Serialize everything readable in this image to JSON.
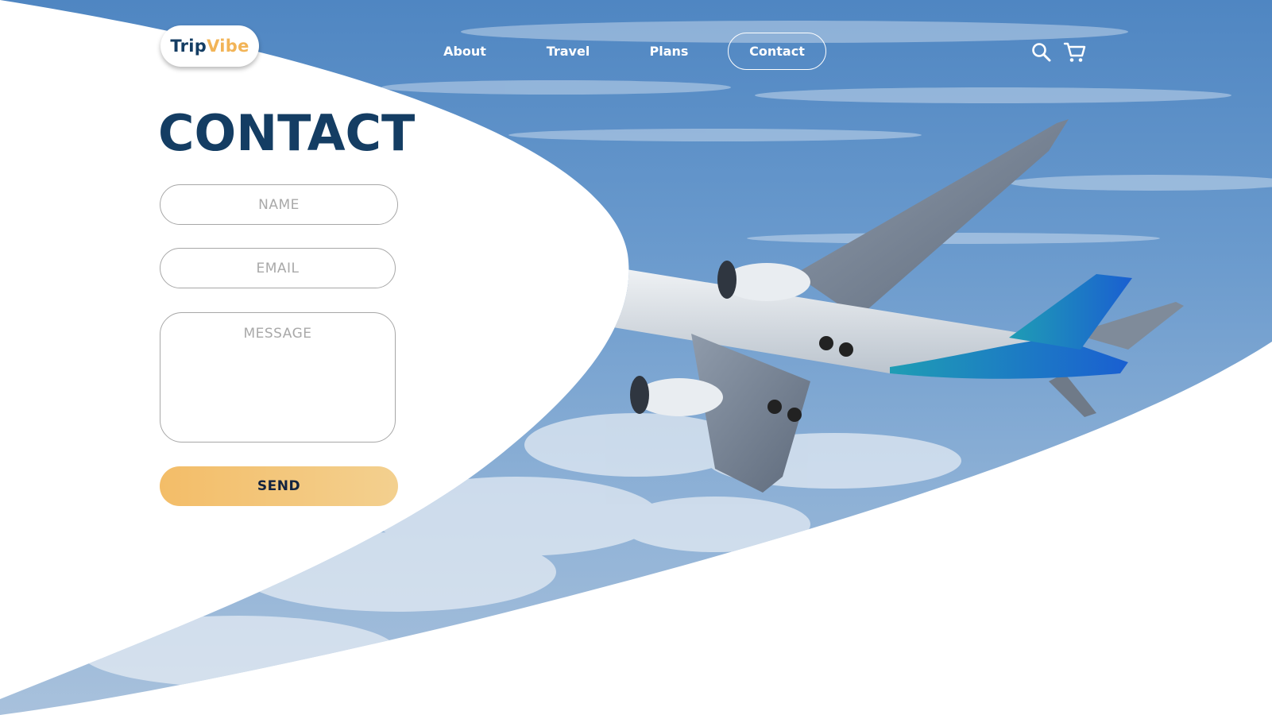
{
  "brand": {
    "logo_part1": "Trip",
    "logo_part2": "Vibe",
    "colors": {
      "navy": "#143d63",
      "orange": "#f2b457",
      "send_gradient_start": "#f3bd68",
      "send_gradient_end": "#f3d08f"
    }
  },
  "nav": {
    "items": [
      {
        "label": "About"
      },
      {
        "label": "Travel"
      },
      {
        "label": "Plans"
      },
      {
        "label": "Contact",
        "active": true
      }
    ]
  },
  "header_icons": {
    "search": "search-icon",
    "cart": "cart-icon"
  },
  "hero": {
    "image": "airplane-in-blue-sky"
  },
  "contact": {
    "title": "CONTACT",
    "name_placeholder": "NAME",
    "email_placeholder": "EMAIL",
    "message_placeholder": "MESSAGE",
    "send_label": "SEND"
  }
}
